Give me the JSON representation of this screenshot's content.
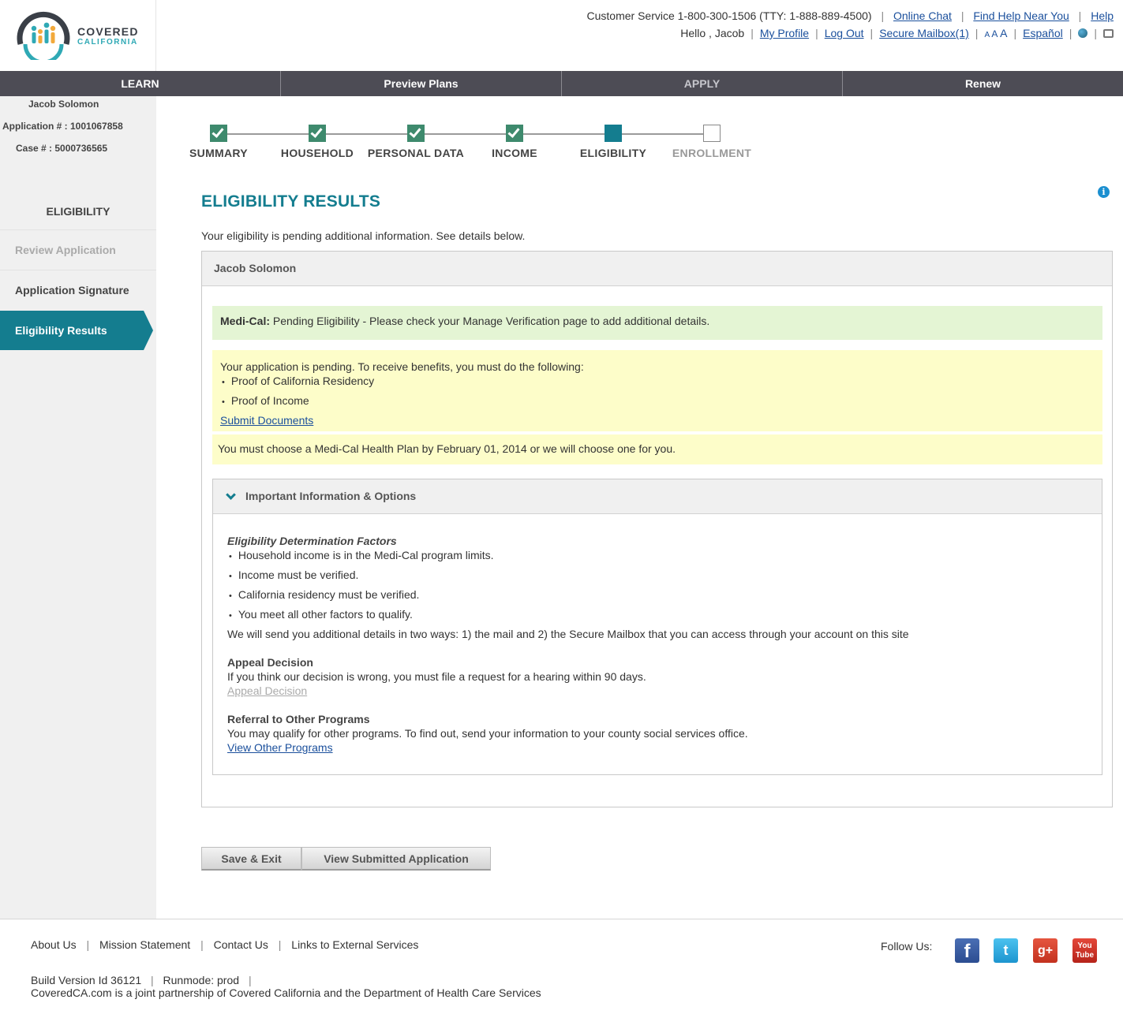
{
  "brand": {
    "line1": "COVERED",
    "line2": "CALIFORNIA"
  },
  "utility": {
    "customer_service": "Customer Service 1-800-300-1506 (TTY: 1-888-889-4500)",
    "online_chat": "Online Chat",
    "find_help": "Find Help Near You",
    "help": "Help",
    "greeting": "Hello , Jacob",
    "my_profile": "My Profile",
    "log_out": "Log Out",
    "secure_mailbox": "Secure Mailbox(1)",
    "text_size": [
      "A",
      "A",
      "A"
    ],
    "espanol": "Español"
  },
  "nav": [
    "LEARN",
    "Preview Plans",
    "APPLY",
    "Renew"
  ],
  "sidebar": {
    "name": "Jacob Solomon",
    "application": "Application # : 1001067858",
    "case": "Case # : 5000736565",
    "heading": "ELIGIBILITY",
    "items": [
      "Review Application",
      "Application Signature",
      "Eligibility Results"
    ]
  },
  "progress": {
    "steps": [
      "SUMMARY",
      "HOUSEHOLD",
      "PERSONAL DATA",
      "INCOME",
      "ELIGIBILITY",
      "ENROLLMENT"
    ],
    "states": [
      "done",
      "done",
      "done",
      "done",
      "current",
      "todo"
    ]
  },
  "main": {
    "title": "ELIGIBILITY RESULTS",
    "intro": "Your eligibility is pending additional information. See details below.",
    "person": "Jacob Solomon",
    "medical_label": "Medi-Cal:",
    "medical_text": " Pending Eligibility - Please check your Manage Verification page to add additional details.",
    "pending_text": "Your application is pending. To receive benefits, you must do the following:",
    "pending_items": [
      "Proof of California Residency",
      "Proof of Income"
    ],
    "submit_documents": "Submit Documents",
    "choose_plan": "You must choose a Medi-Cal Health Plan by February 01, 2014 or we will choose one for you.",
    "accordion_title": "Important Information & Options",
    "factors_title": "Eligibility Determination Factors",
    "factors": [
      "Household income is in the Medi-Cal program limits.",
      "Income must be verified.",
      "California residency must be verified.",
      "You meet all other factors to qualify."
    ],
    "details_text": "We will send you additional details in two ways: 1) the mail and 2) the Secure Mailbox that you can access through your account on this site",
    "appeal_title": "Appeal Decision",
    "appeal_text": "If you think our decision is wrong, you must file a request for a hearing within 90 days.",
    "appeal_link": "Appeal Decision",
    "referral_title": "Referral to Other Programs",
    "referral_text": "You may qualify for other programs. To find out, send your information to your county social services office.",
    "referral_link": "View Other Programs",
    "save_exit": "Save & Exit",
    "view_submitted": "View Submitted Application"
  },
  "footer": {
    "links": [
      "About Us",
      "Mission Statement",
      "Contact Us",
      "Links to External Services"
    ],
    "follow": "Follow Us:",
    "social": {
      "facebook": "f",
      "twitter": "t",
      "googleplus": "g+",
      "youtube_top": "You",
      "youtube_bottom": "Tube"
    },
    "build": "Build Version Id 36121",
    "runmode": "Runmode: prod",
    "partnership": "CoveredCA.com is a joint partnership of Covered California and the Department of Health Care Services"
  },
  "colors": {
    "teal": "#147d8f",
    "nav": "#4d4c55",
    "done_step": "#3e8a6d",
    "green_alert": "#e4f5d4",
    "yellow_alert": "#fdfdc9"
  }
}
